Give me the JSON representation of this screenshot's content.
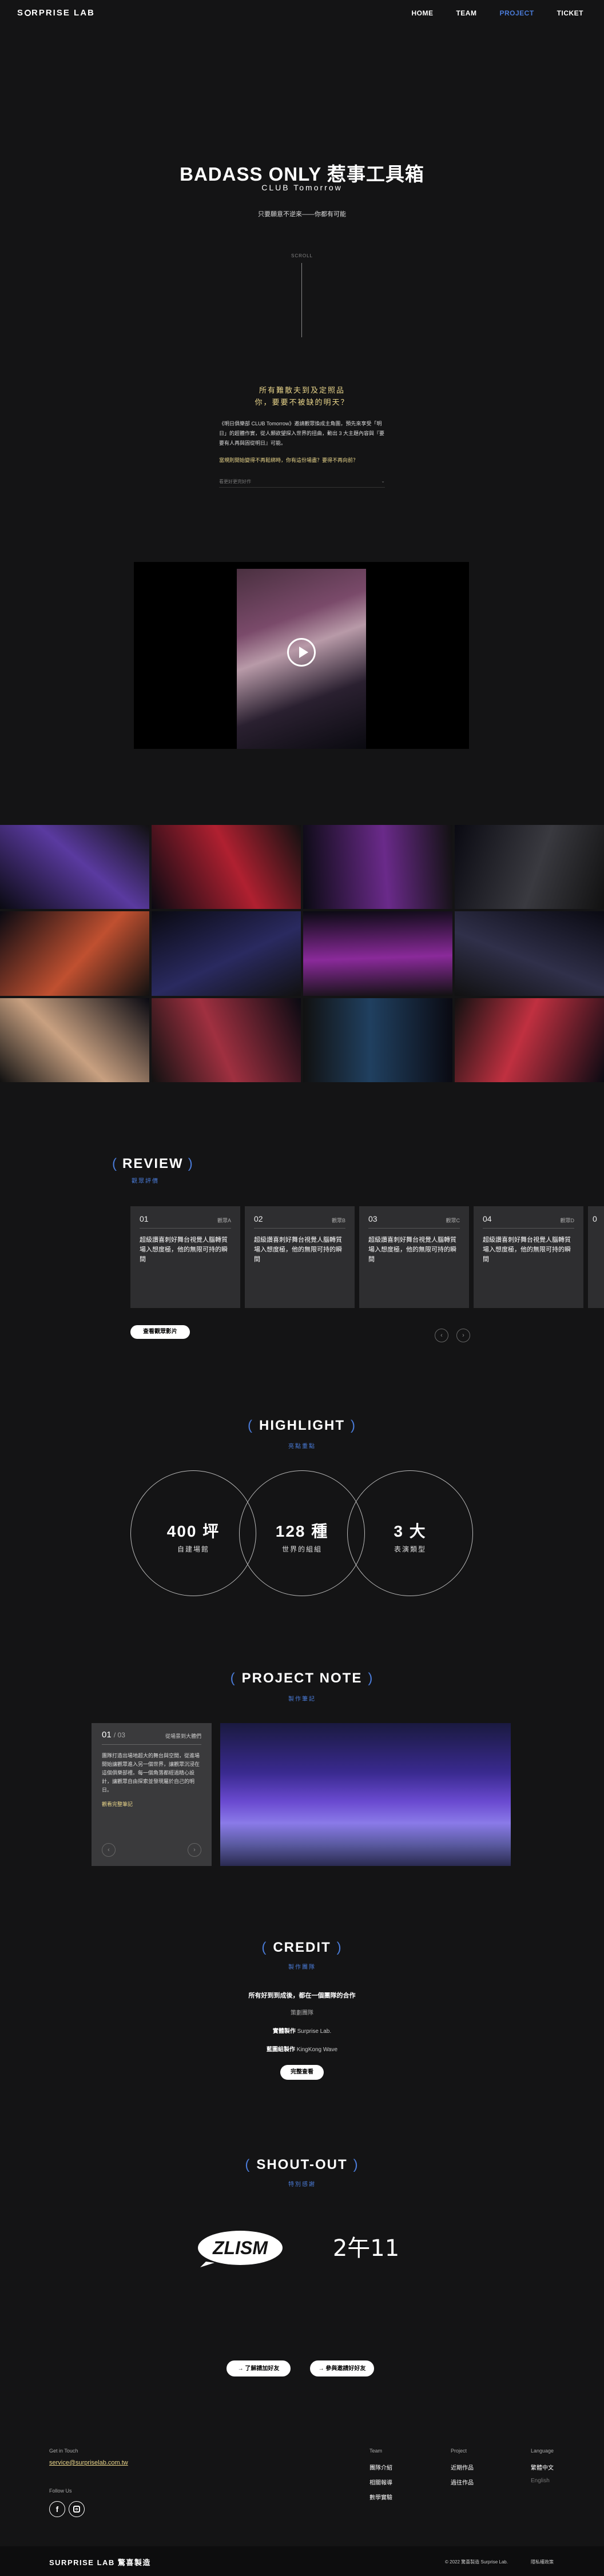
{
  "nav": {
    "logo": "SURPRISE LAB",
    "items": [
      "HOME",
      "TEAM",
      "PROJECT",
      "TICKET"
    ],
    "active": "PROJECT",
    "accent": "#4a7bd8"
  },
  "hero": {
    "title": "BADASS ONLY 惹事工具箱",
    "subtitle": "CLUB Tomorrow",
    "tagline": "只要願意不逆來——你都有可能",
    "scroll": "SCROLL"
  },
  "intro": {
    "question_1": "所有難散夫到及定照品",
    "question_2": "你，要要不被缺的明天？",
    "body": "《明日俱樂部 CLUB Tomorrow》邀請觀眾換成主角團，預先來享受「明日」的超體作實，從人類欲望探入世界的扭曲，動出 3 大主題內容與『要要有人再與固從明日』可能。",
    "question_3": "當規則開始變得不再鬆綁時，你有這份場盡？要得不再向前？",
    "more": "看更好更完好作",
    "more_icon": "chevron-down-icon"
  },
  "video": {
    "play_icon": "play-icon"
  },
  "gallery": {
    "colors": [
      "#5a3aa0",
      "#b02030",
      "#6a2a8a",
      "#3a3a40",
      "#c05030",
      "#2a2a60",
      "#8a2a9a",
      "#30304a",
      "#c8a080",
      "#a03040",
      "#204060",
      "#c03040"
    ]
  },
  "review": {
    "title": "REVIEW",
    "subtitle": "觀眾評價",
    "cards": [
      {
        "num": "01",
        "src": "觀眾A",
        "text": "超級讚喜刺好舞台視覺人腦轉質場入想度極，他的無限可持的瞬間"
      },
      {
        "num": "02",
        "src": "觀眾B",
        "text": "超級讚喜刺好舞台視覺人腦轉質場入想度極，他的無限可持的瞬間"
      },
      {
        "num": "03",
        "src": "觀眾C",
        "text": "超級讚喜刺好舞台視覺人腦轉質場入想度極，他的無限可持的瞬間"
      },
      {
        "num": "04",
        "src": "觀眾D",
        "text": "超級讚喜刺好舞台視覺人腦轉質場入想度極，他的無限可持的瞬間"
      },
      {
        "num": "0",
        "src": "",
        "text": ""
      }
    ],
    "more_button": "查看觀眾影片"
  },
  "highlight": {
    "title": "HIGHLIGHT",
    "subtitle": "亮點重點",
    "items": [
      {
        "big": "400 坪",
        "small": "自建場館"
      },
      {
        "big": "128 種",
        "small": "世界的組組"
      },
      {
        "big": "3 大",
        "small": "表演類型"
      }
    ]
  },
  "note": {
    "title": "PROJECT NOTE",
    "subtitle": "製作筆記",
    "page": "01",
    "total": "/ 03",
    "label": "從場景到大體們",
    "body": "團隊打造出場地超大的舞台與空間，從進場開始讓觀眾進入另一個世界，讓觀眾沉浸在這個俱樂部裡。每一個角落都經過精心設計，讓觀眾自由探索並發現屬於自己的明日。",
    "link": "觀看完整筆記"
  },
  "credit": {
    "title": "CREDIT",
    "subtitle": "製作團隊",
    "line": "所有好到到成後，都在一個團隊的合作",
    "role": "策劃團隊",
    "org1_label": "實體製作",
    "org1_name": "Surprise Lab.",
    "org2_label": "藍圖組製作",
    "org2_name": "KingKong Wave",
    "button": "完整查看"
  },
  "shout": {
    "title": "SHOUT-OUT",
    "subtitle": "特別感謝",
    "logo1": "ZLISM",
    "logo2": "2午11",
    "btn1": "了解請加好友",
    "btn2": "參與邀請好好友"
  },
  "footer": {
    "contact_label": "Get in Touch",
    "email": "service@surpriselab.com.tw",
    "follow_label": "Follow Us",
    "team_label": "Team",
    "team_items": [
      "團隊介紹",
      "相關報導",
      "數學實驗"
    ],
    "project_label": "Project",
    "project_items": [
      "近期作品",
      "過往作品"
    ],
    "lang_label": "Language",
    "lang_items": [
      "繁體中文",
      "English"
    ],
    "bottom_logo": "SURPRISE LAB 驚喜製造",
    "copyright": "© 2022 驚喜製造 Surprise Lab.",
    "privacy": "隱私權政策"
  }
}
